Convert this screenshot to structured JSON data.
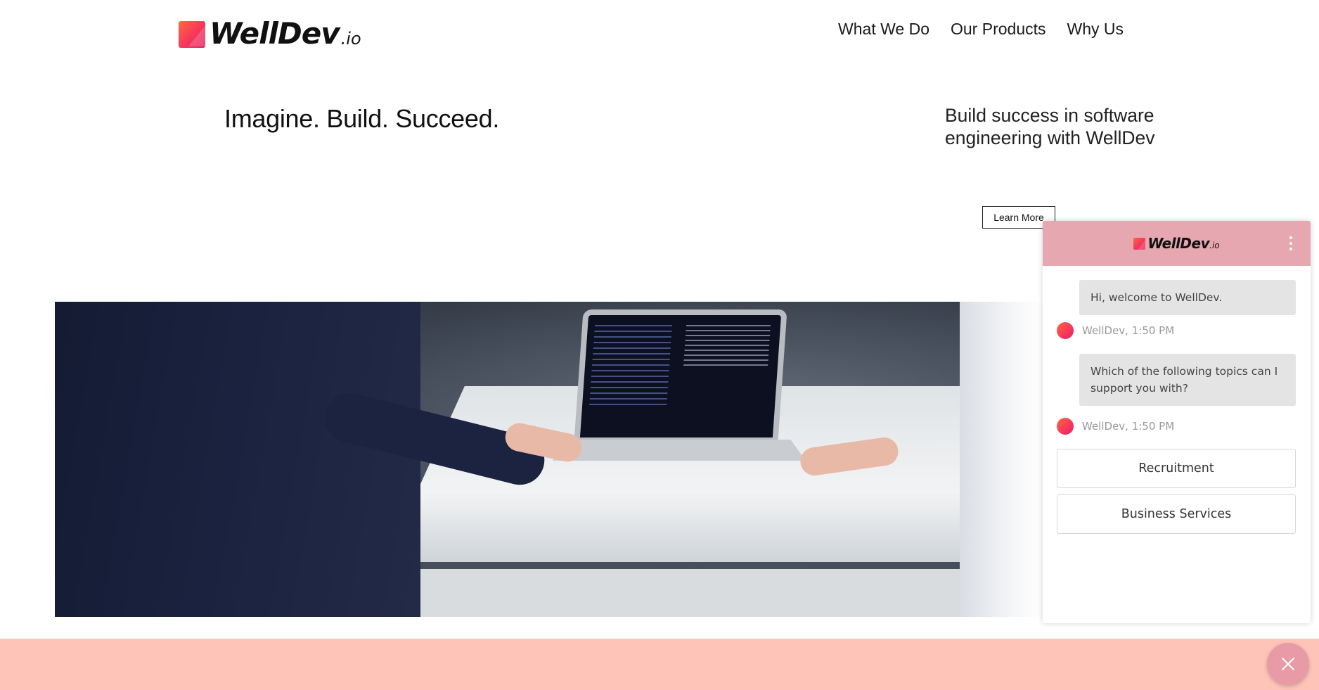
{
  "header": {
    "logo_text": "WellDev",
    "logo_suffix": ".io",
    "nav": [
      {
        "label": "What We Do"
      },
      {
        "label": "Our Products"
      },
      {
        "label": "Why Us"
      }
    ]
  },
  "hero": {
    "title": "Imagine. Build. Succeed.",
    "subtitle": "Build success in software engineering with WellDev",
    "cta_label": "Learn More"
  },
  "chat": {
    "logo_text": "WellDev",
    "logo_suffix": ".io",
    "messages": [
      {
        "text": "Hi, welcome to WellDev.",
        "meta": "WellDev, 1:50 PM"
      },
      {
        "text": "Which of the following topics can I support you with?",
        "meta": "WellDev, 1:50 PM"
      }
    ],
    "options": [
      {
        "label": "Recruitment"
      },
      {
        "label": "Business Services"
      }
    ]
  },
  "colors": {
    "brand_gradient_start": "#ff6a3d",
    "brand_gradient_end": "#e0245e",
    "chat_header": "#e6a7b0",
    "pink_band": "#fec4b8",
    "fab": "#e89aa6"
  },
  "icons": {
    "menu": "kebab-icon",
    "close": "close-icon"
  }
}
